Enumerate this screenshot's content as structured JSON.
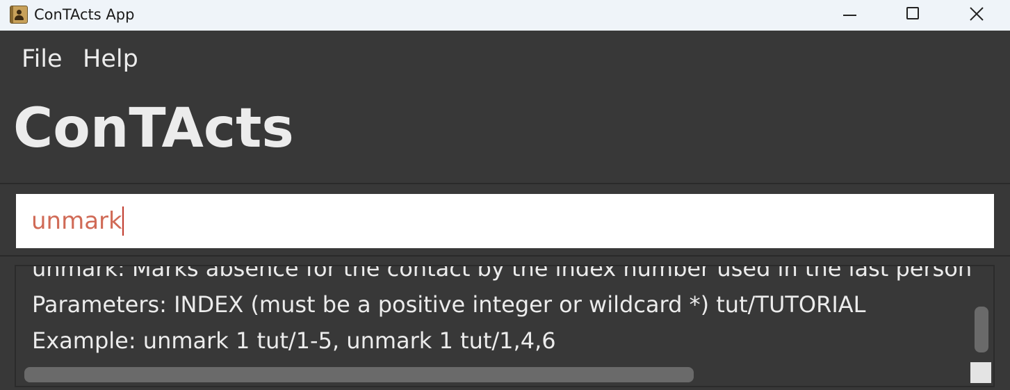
{
  "window": {
    "title": "ConTActs App",
    "icon": "contacts-book-icon",
    "controls": {
      "minimize": "minimize-icon",
      "maximize": "maximize-icon",
      "close": "close-icon"
    }
  },
  "menu": {
    "items": [
      {
        "label": "File"
      },
      {
        "label": "Help"
      }
    ]
  },
  "header": {
    "title": "ConTActs"
  },
  "command_box": {
    "value": "unmark",
    "text_color": "#d06a56"
  },
  "result_display": {
    "lines": [
      "unmark: Marks absence for the contact by the index number used in the last person listing and",
      "Parameters: INDEX (must be a positive integer or wildcard *) tut/TUTORIAL",
      "Example: unmark 1 tut/1-5, unmark 1 tut/1,4,6"
    ]
  },
  "colors": {
    "background": "#383838",
    "titlebar": "#eff4f9",
    "text": "#ececec",
    "input_background": "#ffffff"
  }
}
